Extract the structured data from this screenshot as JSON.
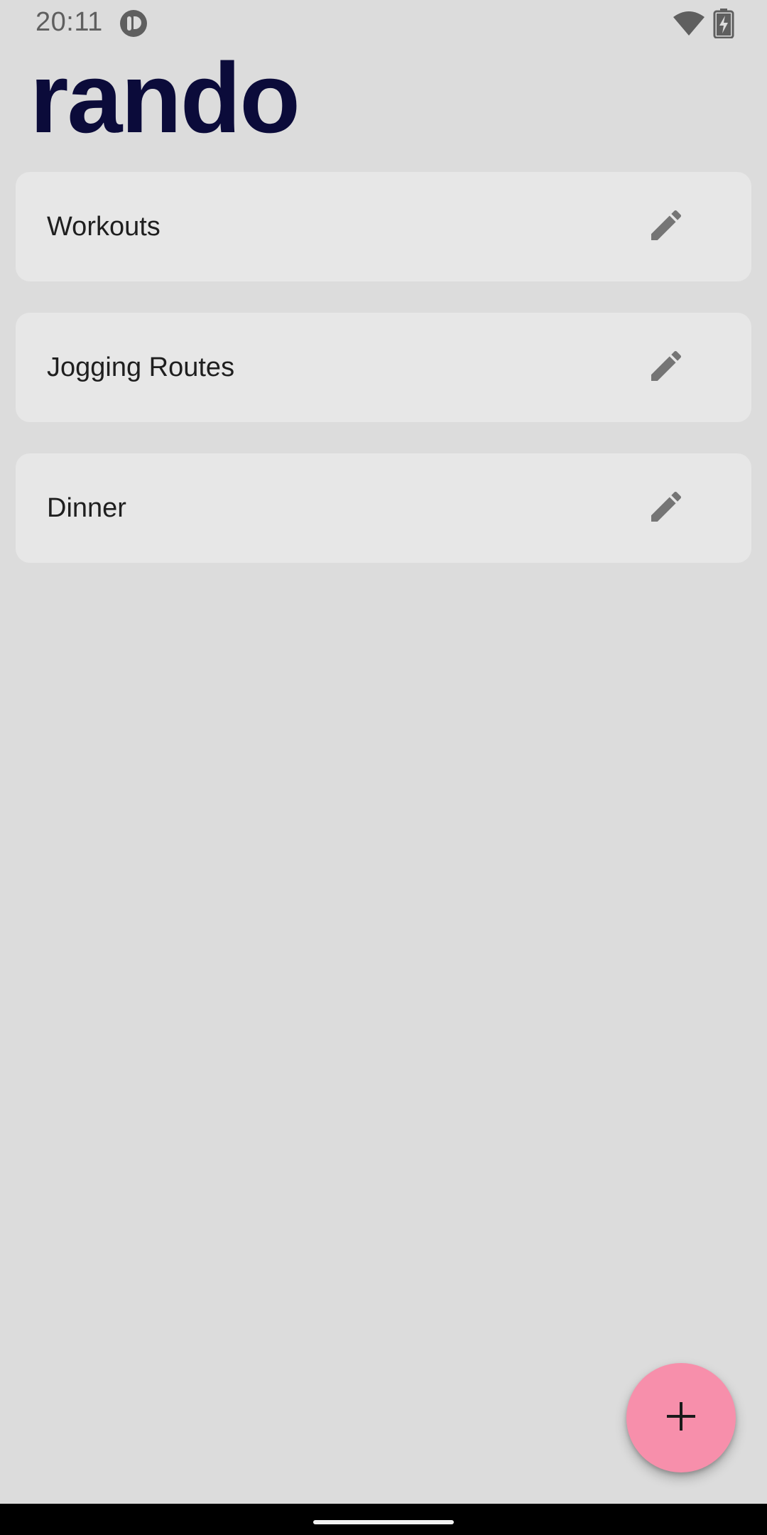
{
  "status_bar": {
    "time": "20:11",
    "notification_icon": "app-notification-icon",
    "wifi_icon": "wifi-icon",
    "battery_icon": "battery-charging-icon"
  },
  "app": {
    "title": "rando",
    "title_color": "#0b0b3a",
    "background": "#dcdcdc"
  },
  "lists": [
    {
      "label": "Workouts",
      "action_icon": "pencil-icon"
    },
    {
      "label": "Jogging Routes",
      "action_icon": "pencil-icon"
    },
    {
      "label": "Dinner",
      "action_icon": "pencil-icon"
    }
  ],
  "fab": {
    "icon": "plus-icon",
    "color": "#f78fab"
  }
}
